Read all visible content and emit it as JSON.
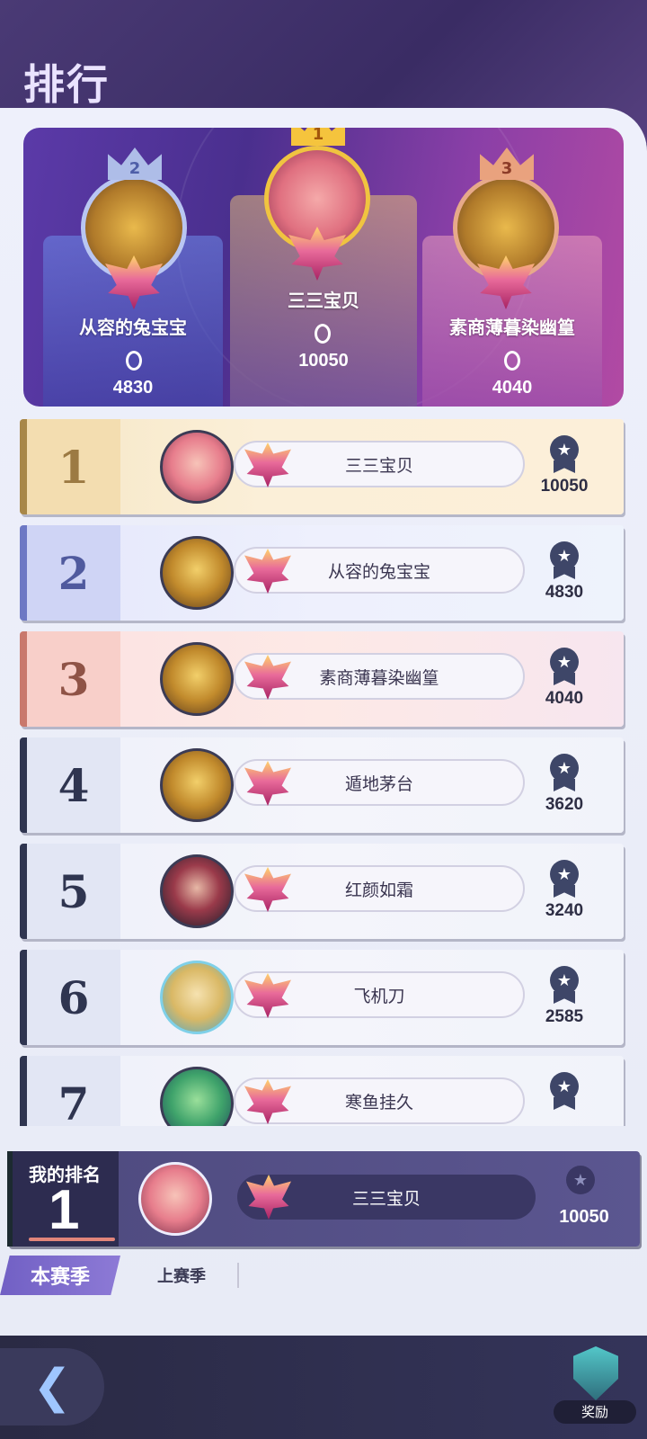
{
  "header": {
    "title": "排行"
  },
  "podium": [
    {
      "rank_badge": "2",
      "name": "从容的兔宝宝",
      "score": "4830"
    },
    {
      "rank_badge": "1",
      "name": "三三宝贝",
      "score": "10050"
    },
    {
      "rank_badge": "3",
      "name": "素商薄暮染幽篁",
      "score": "4040"
    }
  ],
  "leaderboard": [
    {
      "rank": "1",
      "name": "三三宝贝",
      "score": "10050"
    },
    {
      "rank": "2",
      "name": "从容的兔宝宝",
      "score": "4830"
    },
    {
      "rank": "3",
      "name": "素商薄暮染幽篁",
      "score": "4040"
    },
    {
      "rank": "4",
      "name": "遁地茅台",
      "score": "3620"
    },
    {
      "rank": "5",
      "name": "红颜如霜",
      "score": "3240"
    },
    {
      "rank": "6",
      "name": "飞机刀",
      "score": "2585"
    },
    {
      "rank": "7",
      "name": "寒鱼挂久",
      "score": ""
    }
  ],
  "my_rank": {
    "label": "我的排名",
    "rank": "1",
    "name": "三三宝贝",
    "score": "10050"
  },
  "season_tabs": {
    "current": "本赛季",
    "last": "上赛季"
  },
  "footer": {
    "back_icon": "back-arrow-icon",
    "reward_label": "奖励"
  },
  "colors": {
    "accent": "#7160c4",
    "gold": "#f5c43d",
    "panel": "#eef0fb"
  }
}
